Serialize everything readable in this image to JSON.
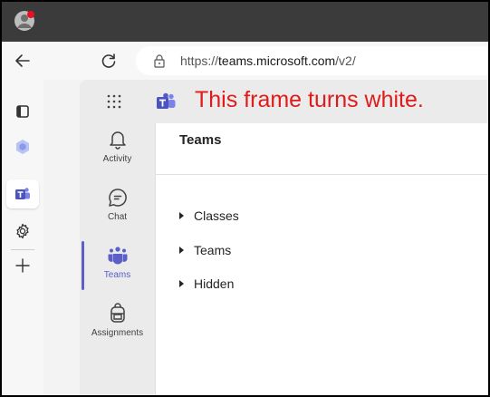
{
  "browser": {
    "url_prefix": "https://",
    "url_domain": "teams.microsoft.com",
    "url_path": "/v2/",
    "back_icon": "back-arrow-icon",
    "refresh_icon": "refresh-icon",
    "edge_sidebar": [
      {
        "name": "tabs-icon"
      },
      {
        "name": "copilot-icon"
      },
      {
        "name": "teams-icon",
        "active": true
      },
      {
        "name": "gear-icon"
      },
      {
        "name": "add-icon"
      }
    ]
  },
  "teams": {
    "annotation": "This frame turns white.",
    "rail": [
      {
        "label": "Activity",
        "icon": "bell-icon"
      },
      {
        "label": "Chat",
        "icon": "chat-icon"
      },
      {
        "label": "Teams",
        "icon": "teams-people-icon",
        "active": true
      },
      {
        "label": "Assignments",
        "icon": "backpack-icon"
      }
    ],
    "title": "Teams",
    "tree": [
      "Classes",
      "Teams",
      "Hidden"
    ]
  },
  "colors": {
    "titlebar": "#3b3b3b",
    "accent": "#5b5fc7",
    "annotation": "#e01b1b",
    "profile_badge": "#e81123"
  }
}
